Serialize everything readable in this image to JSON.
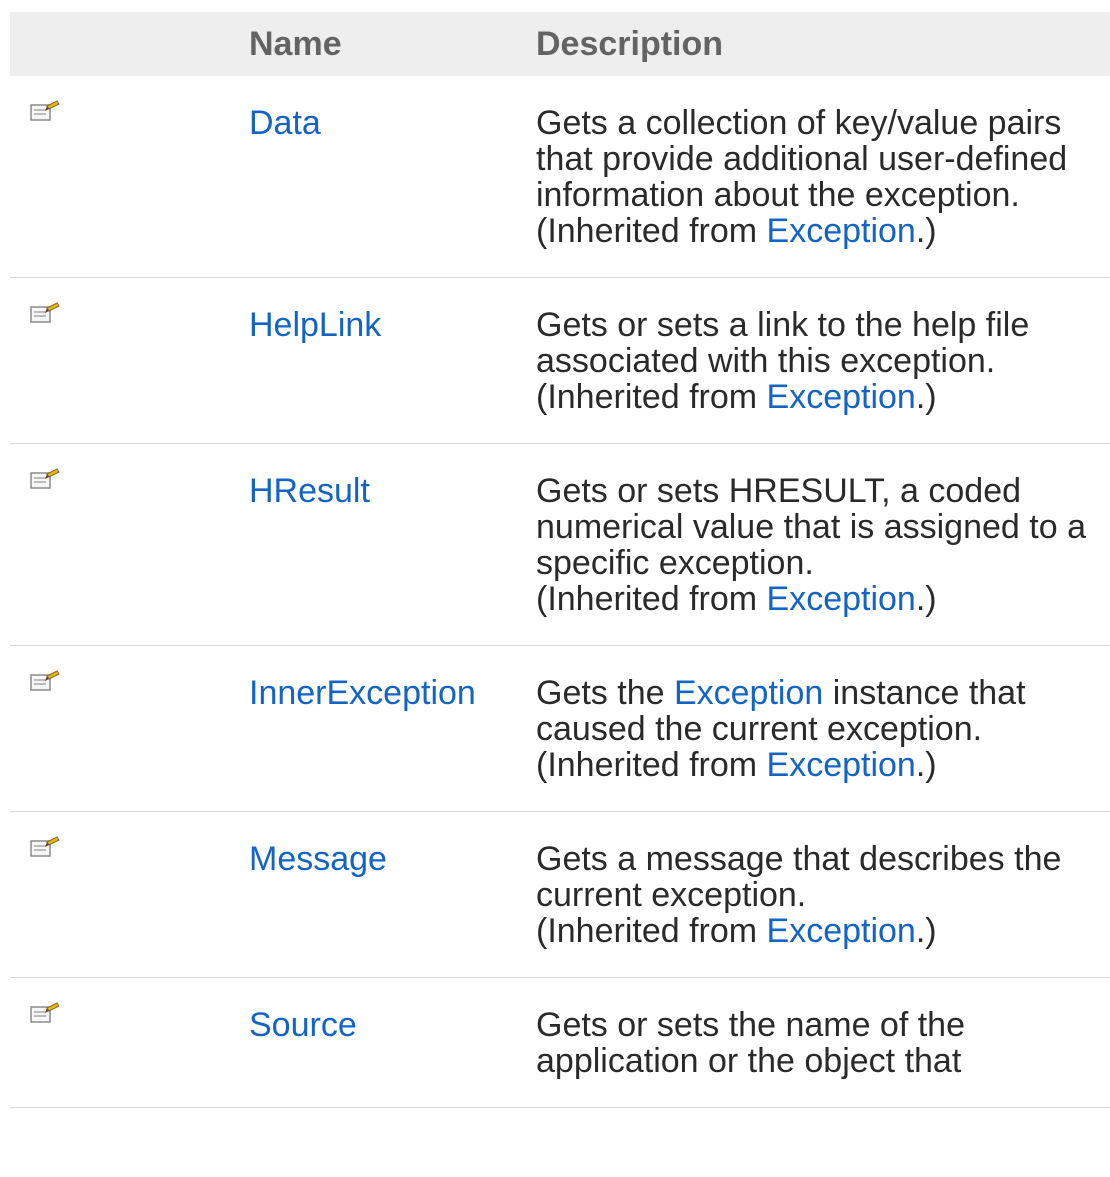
{
  "table": {
    "headers": {
      "icon": "",
      "name": "Name",
      "description": "Description"
    },
    "rows": [
      {
        "icon": "property-icon",
        "name": "Data",
        "description": "Gets a collection of key/value pairs that provide additional user-defined information about the exception.",
        "inherited_prefix": "(Inherited from ",
        "inherited_link": "Exception",
        "inherited_suffix": ".)"
      },
      {
        "icon": "property-icon",
        "name": "HelpLink",
        "description": "Gets or sets a link to the help file associated with this exception.",
        "inherited_prefix": "(Inherited from ",
        "inherited_link": "Exception",
        "inherited_suffix": ".)"
      },
      {
        "icon": "property-icon",
        "name": "HResult",
        "description": "Gets or sets HRESULT, a coded numerical value that is assigned to a specific exception.",
        "inherited_prefix": "(Inherited from ",
        "inherited_link": "Exception",
        "inherited_suffix": ".)"
      },
      {
        "icon": "property-icon",
        "name": "InnerException",
        "description_prefix": "Gets the ",
        "description_link": "Exception",
        "description_suffix": " instance that caused the current exception.",
        "inherited_prefix": "(Inherited from ",
        "inherited_link": "Exception",
        "inherited_suffix": ".)"
      },
      {
        "icon": "property-icon",
        "name": "Message",
        "description": "Gets a message that describes the current exception.",
        "inherited_prefix": "(Inherited from ",
        "inherited_link": "Exception",
        "inherited_suffix": ".)"
      },
      {
        "icon": "property-icon",
        "name": "Source",
        "description": "Gets or sets the name of the application or the object that"
      }
    ]
  },
  "colors": {
    "link": "#1364c4",
    "header_bg": "#eeeeee",
    "header_text": "#636363",
    "row_border": "#d9d9d9",
    "text": "#2a2a2a"
  }
}
